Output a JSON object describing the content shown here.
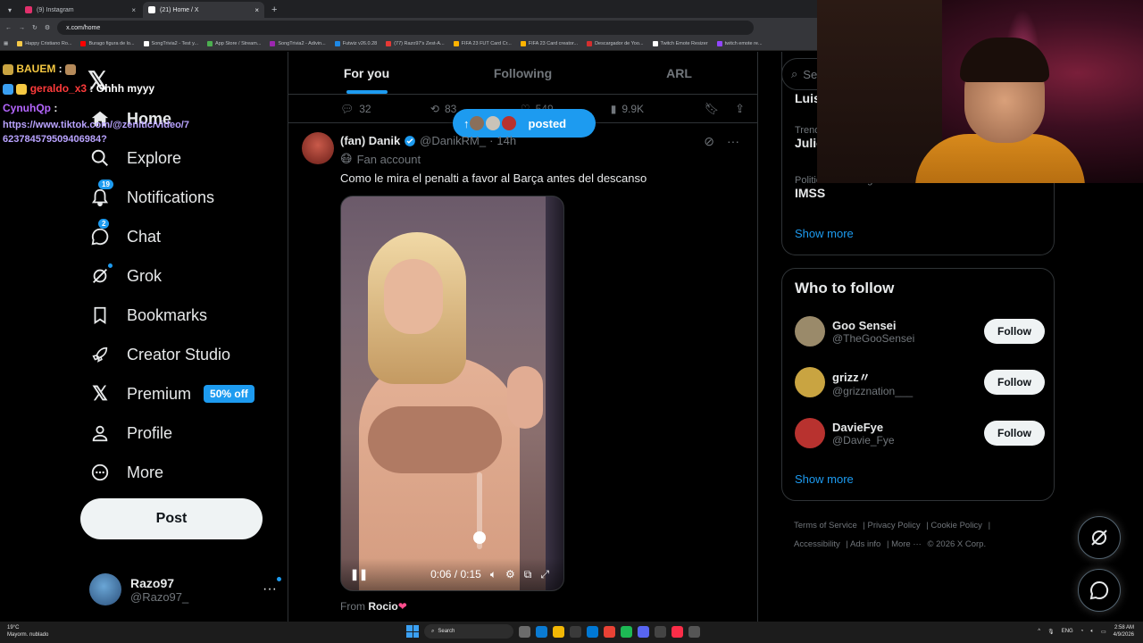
{
  "browser": {
    "tabs": [
      {
        "title": "(9) Instagram",
        "color": "#e1306c",
        "active": false
      },
      {
        "title": "(21) Home / X",
        "color": "#ffffff",
        "active": true
      }
    ],
    "url": "x.com/home",
    "bookmarks": [
      "Happy Cristiano Ro...",
      "Burago figura de lo...",
      "SongTrivia2 - Test y...",
      "App Store / Stream...",
      "SongTrivia2 - Adivin...",
      "Futwiz v26.0.28",
      "(77) Razo97's Zest-A...",
      "FIFA 23 FUT Card Cr...",
      "FIFA 23 Card creator...",
      "Descargador de Yoo...",
      "Twitch Emote Resizer",
      "twitch emote re..."
    ]
  },
  "chat": [
    {
      "user": "BAUEM",
      "text": ""
    },
    {
      "user": "geraldo_x3",
      "text": "Ohhh myyy"
    },
    {
      "user": "CynuhQp",
      "text": ""
    },
    {
      "link": "https://www.tiktok.com/@zenitic/video/7623784579509406984?"
    }
  ],
  "nav": {
    "items": [
      {
        "label": "Home",
        "icon": "home-icon"
      },
      {
        "label": "Explore",
        "icon": "search-icon"
      },
      {
        "label": "Notifications",
        "icon": "bell-icon",
        "badge": "19"
      },
      {
        "label": "Chat",
        "icon": "chat-icon",
        "badge": "2"
      },
      {
        "label": "Grok",
        "icon": "grok-icon"
      },
      {
        "label": "Bookmarks",
        "icon": "bookmark-icon"
      },
      {
        "label": "Creator Studio",
        "icon": "rocket-icon"
      },
      {
        "label": "Premium",
        "icon": "x-logo-icon",
        "promo": "50% off"
      },
      {
        "label": "Profile",
        "icon": "person-icon"
      },
      {
        "label": "More",
        "icon": "more-circle-icon"
      }
    ],
    "post_label": "Post",
    "account": {
      "name": "Razo97",
      "handle": "@Razo97_"
    }
  },
  "feed": {
    "tabs": [
      "For you",
      "Following",
      "ARL"
    ],
    "prev_tweet_actions": {
      "replies": "32",
      "reposts": "83",
      "likes": "549",
      "views": "9.9K"
    },
    "new_posts_pill": "posted",
    "tweet": {
      "name": "(fan) Danik",
      "handle": "@DanikRM_",
      "time": "14h",
      "sub": "Fan account",
      "text": "Como le mira el penalti a favor al Barça antes del descanso",
      "video_time": "0:06 / 0:15",
      "volume_level": 0.08,
      "from_label": "From",
      "from_name": "Rocio"
    }
  },
  "sidebar": {
    "search_placeholder": "Se",
    "trends": [
      {
        "meta": "",
        "title": "Luis"
      },
      {
        "meta": "Trend",
        "title": "Julic"
      },
      {
        "meta": "Politics · Trending",
        "title": "IMSS"
      }
    ],
    "show_more": "Show more",
    "who_to_follow": {
      "title": "Who to follow",
      "users": [
        {
          "name": "Goo Sensei",
          "handle": "@TheGooSensei",
          "color": "#9a8a6a"
        },
        {
          "name": "grizz〃",
          "handle": "@grizznation___",
          "color": "#c9a441"
        },
        {
          "name": "DavieFye",
          "handle": "@Davie_Fye",
          "color": "#b8322f"
        }
      ],
      "follow_label": "Follow",
      "show_more": "Show more"
    },
    "footer": {
      "links": [
        "Terms of Service",
        "Privacy Policy",
        "Cookie Policy",
        "Accessibility",
        "Ads info",
        "More ···"
      ],
      "copyright": "© 2026 X Corp."
    }
  },
  "taskbar": {
    "weather_temp": "19°C",
    "weather_desc": "Mayorm. nublado",
    "search": "Search",
    "lang": "ENG",
    "time": "2:58 AM",
    "date": "4/9/2026"
  },
  "colors": {
    "accent": "#1d9bf0",
    "background": "#000000"
  }
}
